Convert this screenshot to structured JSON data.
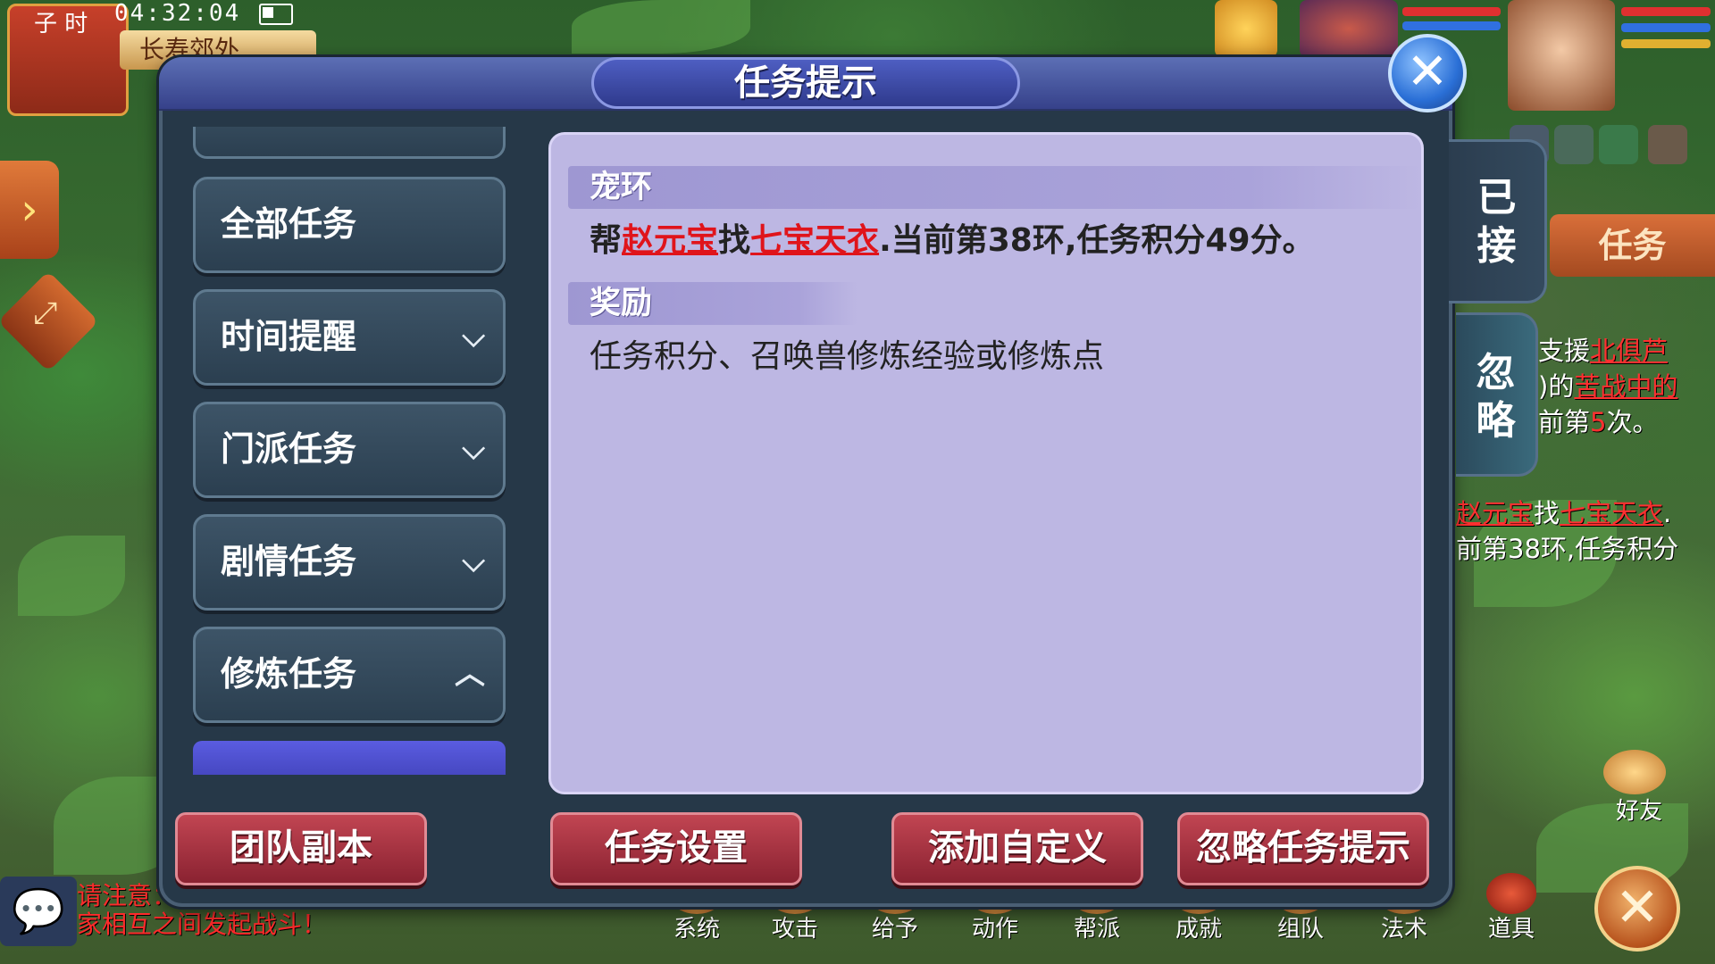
{
  "status": {
    "time_period": "子 时",
    "clock": "04:32:04",
    "map_name": "长寿郊外"
  },
  "dialog": {
    "title": "任务提示",
    "close_symbol": "✕",
    "categories": [
      {
        "label": "全部任务",
        "chevron": ""
      },
      {
        "label": "时间提醒",
        "chevron": "⌵"
      },
      {
        "label": "门派任务",
        "chevron": "⌵"
      },
      {
        "label": "剧情任务",
        "chevron": "⌵"
      },
      {
        "label": "修炼任务",
        "chevron": "︿"
      }
    ],
    "content": {
      "section1_title": "宠环",
      "line1_prefix": "帮",
      "line1_npc": "赵元宝",
      "line1_mid": "找",
      "line1_item": "七宝天衣",
      "line1_suffix": ".当前第38环,任务积分49分。",
      "section2_title": "奖励",
      "reward_text": "任务积分、召唤兽修炼经验或修炼点"
    },
    "side_tabs": {
      "accepted": "已接",
      "ignored": "忽略"
    },
    "buttons": {
      "team_dungeon": "团队副本",
      "task_settings": "任务设置",
      "add_custom": "添加自定义",
      "ignore_tips": "忽略任务提示"
    }
  },
  "background": {
    "task_tab": "任务",
    "bg_line1_a": "支援",
    "bg_line1_b": "北俱芦",
    "bg_line2_a": ")的",
    "bg_line2_b": "苦战中的",
    "bg_line3_a": "前第",
    "bg_line3_b": "5",
    "bg_line3_c": "次。",
    "bg_line4_a": "赵元宝",
    "bg_line4_b": "找",
    "bg_line4_c": "七宝天衣",
    "bg_line4_d": ".",
    "bg_line5": "前第38环,任务积分",
    "chat_text": "请注意：您已进入战斗区域，此区域允许玩家相互之间发起战斗！",
    "friend_label": "好友",
    "bottom_menu": [
      "系统",
      "攻击",
      "给予",
      "动作",
      "帮派",
      "成就",
      "组队",
      "法术",
      "道具"
    ]
  },
  "colors": {
    "dialog_bg": "#263848",
    "content_bg": "#bdb7e3",
    "highlight_red": "#e0141b",
    "button_red": "#a9303e",
    "title_blue": "#3f4aa8"
  }
}
